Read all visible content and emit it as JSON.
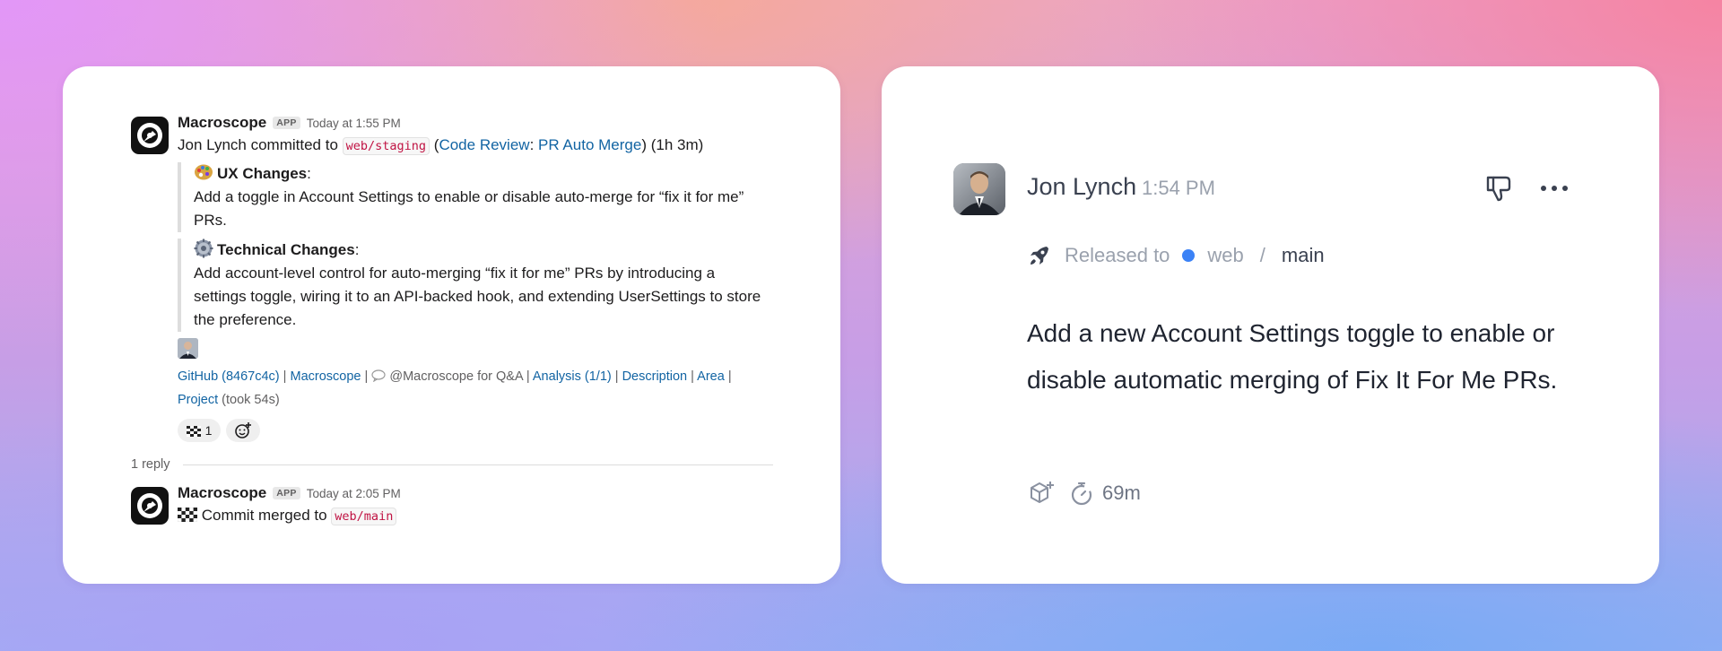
{
  "slack": {
    "message": {
      "sender": "Macroscope",
      "badge": "APP",
      "timestamp": "Today at 1:55 PM",
      "commit_prefix": "Jon Lynch committed to",
      "branch": "web/staging",
      "paren_open": "(",
      "code_review_label": "Code Review",
      "colon": ":",
      "pr_auto_merge_label": "PR Auto Merge",
      "duration": ") (1h 3m)",
      "ux": {
        "title": "UX Changes",
        "colon": ":",
        "body": "Add a toggle in Account Settings to enable or disable auto-merge for “fix it for me” PRs."
      },
      "technical": {
        "title": "Technical Changes",
        "colon": ":",
        "body": "Add account-level control for auto-merging “fix it for me” PRs by introducing a settings toggle, wiring it to an API-backed hook, and extending UserSettings to store the preference."
      },
      "links": {
        "github": "GitHub (8467c4c)",
        "macroscope": "Macroscope",
        "qa": "@Macroscope for Q&A",
        "analysis": "Analysis (1/1)",
        "description": "Description",
        "area": "Area",
        "project": "Project",
        "took": "(took 54s)",
        "separator": "|"
      },
      "reactions": [
        {
          "icon": "checkered-flag-icon",
          "count": "1"
        }
      ]
    },
    "replies_label": "1 reply",
    "reply": {
      "sender": "Macroscope",
      "badge": "APP",
      "timestamp": "Today at 2:05 PM",
      "text": "Commit merged to",
      "branch": "web/main"
    }
  },
  "card": {
    "author": "Jon Lynch",
    "time": "1:54 PM",
    "released_label": "Released to",
    "repo": "web",
    "slash": "/",
    "branch": "main",
    "summary": "Add a new Account Settings toggle to enable or disable automatic merging of Fix It For Me PRs.",
    "duration": "69m"
  },
  "colors": {
    "slack_link": "#1264a3",
    "code_text": "#c01343",
    "repo_dot": "#3b82f6"
  }
}
